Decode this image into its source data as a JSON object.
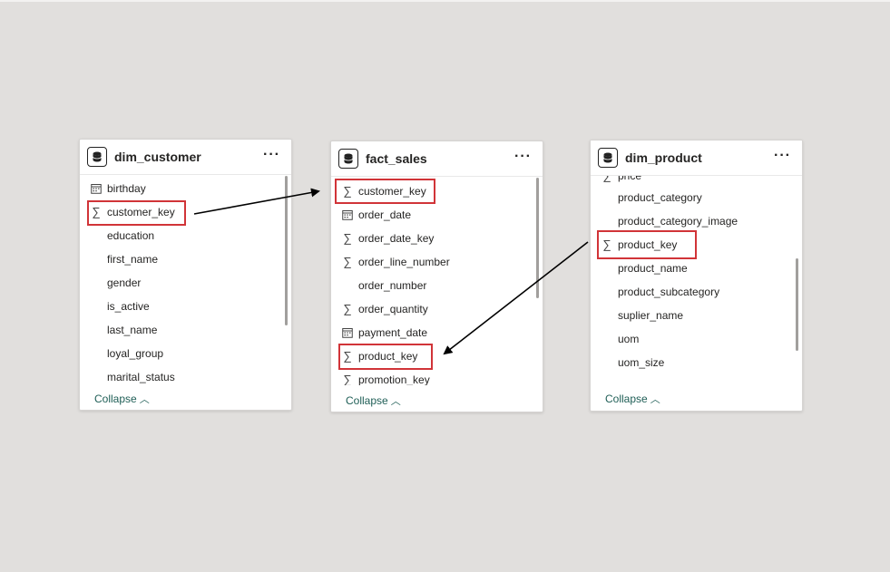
{
  "tables": {
    "dim_customer": {
      "title": "dim_customer",
      "more": "···",
      "collapse": "Collapse",
      "fields": [
        {
          "name": "birthday",
          "icon": "calendar-icon"
        },
        {
          "name": "customer_key",
          "icon": "sigma-icon"
        },
        {
          "name": "education",
          "icon": ""
        },
        {
          "name": "first_name",
          "icon": ""
        },
        {
          "name": "gender",
          "icon": ""
        },
        {
          "name": "is_active",
          "icon": ""
        },
        {
          "name": "last_name",
          "icon": ""
        },
        {
          "name": "loyal_group",
          "icon": ""
        },
        {
          "name": "marital_status",
          "icon": ""
        }
      ]
    },
    "fact_sales": {
      "title": "fact_sales",
      "more": "···",
      "collapse": "Collapse",
      "fields": [
        {
          "name": "customer_key",
          "icon": "sigma-icon"
        },
        {
          "name": "order_date",
          "icon": "calendar-icon"
        },
        {
          "name": "order_date_key",
          "icon": "sigma-icon"
        },
        {
          "name": "order_line_number",
          "icon": "sigma-icon"
        },
        {
          "name": "order_number",
          "icon": ""
        },
        {
          "name": "order_quantity",
          "icon": "sigma-icon"
        },
        {
          "name": "payment_date",
          "icon": "calendar-icon"
        },
        {
          "name": "product_key",
          "icon": "sigma-icon"
        },
        {
          "name": "promotion_key",
          "icon": "sigma-icon"
        }
      ]
    },
    "dim_product": {
      "title": "dim_product",
      "more": "···",
      "collapse": "Collapse",
      "fields": [
        {
          "name": "price",
          "icon": "sigma-icon"
        },
        {
          "name": "product_category",
          "icon": ""
        },
        {
          "name": "product_category_image",
          "icon": ""
        },
        {
          "name": "product_key",
          "icon": "sigma-icon"
        },
        {
          "name": "product_name",
          "icon": ""
        },
        {
          "name": "product_subcategory",
          "icon": ""
        },
        {
          "name": "suplier_name",
          "icon": ""
        },
        {
          "name": "uom",
          "icon": ""
        },
        {
          "name": "uom_size",
          "icon": ""
        }
      ]
    }
  },
  "colors": {
    "canvas": "#e1dfdd",
    "highlight": "#d13438",
    "collapse_link": "#1f5e56"
  }
}
